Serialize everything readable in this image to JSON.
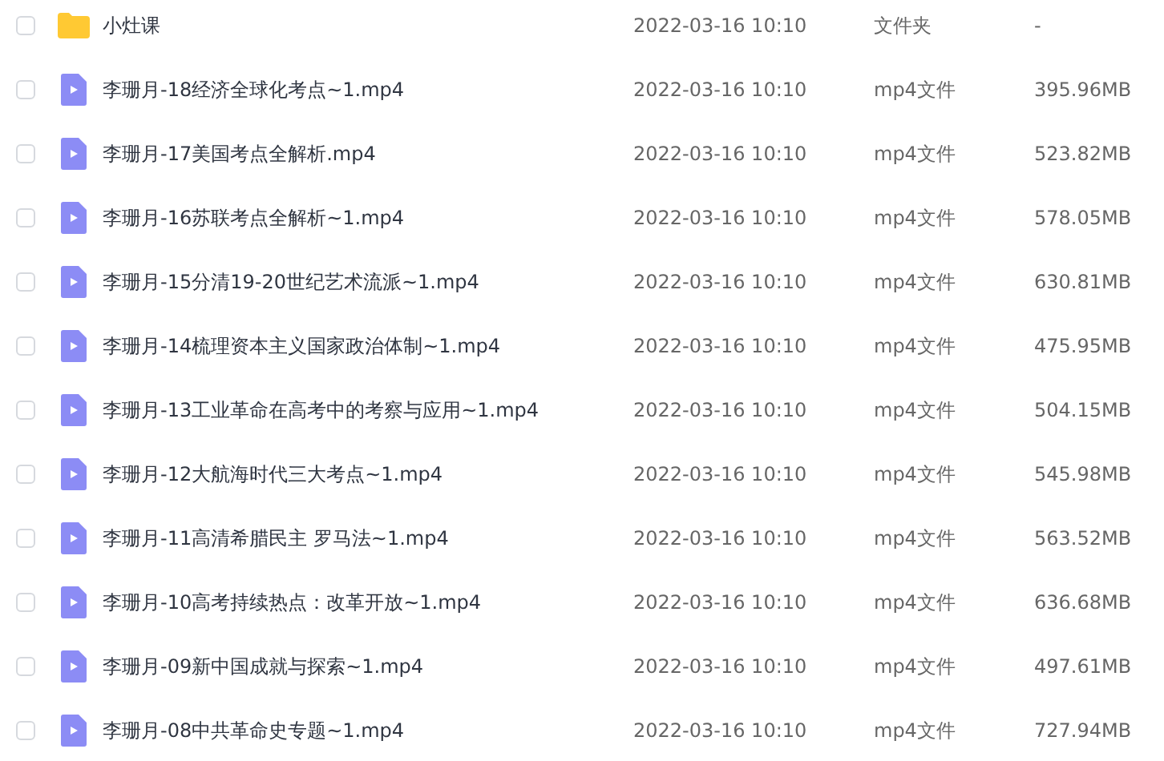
{
  "files": [
    {
      "kind": "folder",
      "checked": false,
      "name": "小灶课",
      "modified": "2022-03-16 10:10",
      "type": "文件夹",
      "size": "-"
    },
    {
      "kind": "video",
      "checked": false,
      "name": "李珊月-18经济全球化考点~1.mp4",
      "modified": "2022-03-16 10:10",
      "type": "mp4文件",
      "size": "395.96MB"
    },
    {
      "kind": "video",
      "checked": false,
      "name": "李珊月-17美国考点全解析.mp4",
      "modified": "2022-03-16 10:10",
      "type": "mp4文件",
      "size": "523.82MB"
    },
    {
      "kind": "video",
      "checked": false,
      "name": "李珊月-16苏联考点全解析~1.mp4",
      "modified": "2022-03-16 10:10",
      "type": "mp4文件",
      "size": "578.05MB"
    },
    {
      "kind": "video",
      "checked": false,
      "name": "李珊月-15分清19-20世纪艺术流派~1.mp4",
      "modified": "2022-03-16 10:10",
      "type": "mp4文件",
      "size": "630.81MB"
    },
    {
      "kind": "video",
      "checked": false,
      "name": "李珊月-14梳理资本主义国家政治体制~1.mp4",
      "modified": "2022-03-16 10:10",
      "type": "mp4文件",
      "size": "475.95MB"
    },
    {
      "kind": "video",
      "checked": false,
      "name": "李珊月-13工业革命在高考中的考察与应用~1.mp4",
      "modified": "2022-03-16 10:10",
      "type": "mp4文件",
      "size": "504.15MB"
    },
    {
      "kind": "video",
      "checked": false,
      "name": "李珊月-12大航海时代三大考点~1.mp4",
      "modified": "2022-03-16 10:10",
      "type": "mp4文件",
      "size": "545.98MB"
    },
    {
      "kind": "video",
      "checked": false,
      "name": "李珊月-11高清希腊民主 罗马法~1.mp4",
      "modified": "2022-03-16 10:10",
      "type": "mp4文件",
      "size": "563.52MB"
    },
    {
      "kind": "video",
      "checked": false,
      "name": "李珊月-10高考持续热点：改革开放~1.mp4",
      "modified": "2022-03-16 10:10",
      "type": "mp4文件",
      "size": "636.68MB"
    },
    {
      "kind": "video",
      "checked": false,
      "name": "李珊月-09新中国成就与探索~1.mp4",
      "modified": "2022-03-16 10:10",
      "type": "mp4文件",
      "size": "497.61MB"
    },
    {
      "kind": "video",
      "checked": false,
      "name": "李珊月-08中共革命史专题~1.mp4",
      "modified": "2022-03-16 10:10",
      "type": "mp4文件",
      "size": "727.94MB"
    }
  ]
}
